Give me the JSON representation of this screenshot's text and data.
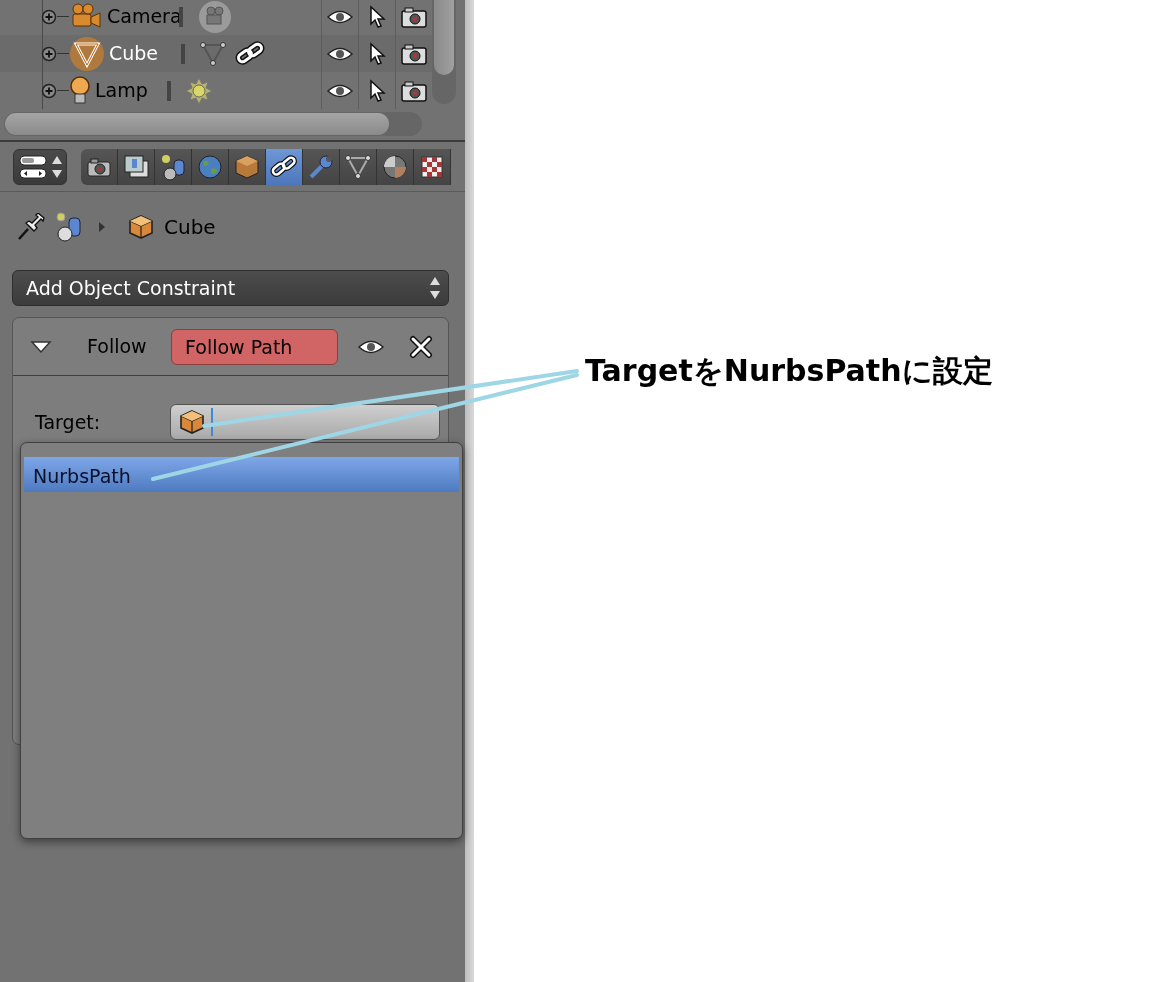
{
  "outliner": {
    "rows": [
      {
        "name": "Camera",
        "kind": "camera",
        "selected": false,
        "has_constraint": false
      },
      {
        "name": "Cube",
        "kind": "mesh",
        "selected": true,
        "has_constraint": true
      },
      {
        "name": "Lamp",
        "kind": "lamp",
        "selected": false,
        "has_constraint": false
      }
    ]
  },
  "properties_tabs": [
    {
      "kind": "render",
      "selected": false
    },
    {
      "kind": "render-layers",
      "selected": false
    },
    {
      "kind": "scene",
      "selected": false
    },
    {
      "kind": "world",
      "selected": false
    },
    {
      "kind": "object",
      "selected": false
    },
    {
      "kind": "constraints",
      "selected": true
    },
    {
      "kind": "modifiers",
      "selected": false
    },
    {
      "kind": "data",
      "selected": false
    },
    {
      "kind": "material",
      "selected": false
    },
    {
      "kind": "texture",
      "selected": false
    }
  ],
  "breadcrumb": {
    "object": "Cube"
  },
  "add_constraint": {
    "label": "Add Object Constraint"
  },
  "constraint": {
    "name": "Follow",
    "type": "Follow Path",
    "expanded": true,
    "target_label": "Target:"
  },
  "target_menu": {
    "items": [
      {
        "label": "NurbsPath",
        "selected": true
      }
    ]
  },
  "annotation": {
    "text": "TargetをNurbsPathに設定"
  }
}
